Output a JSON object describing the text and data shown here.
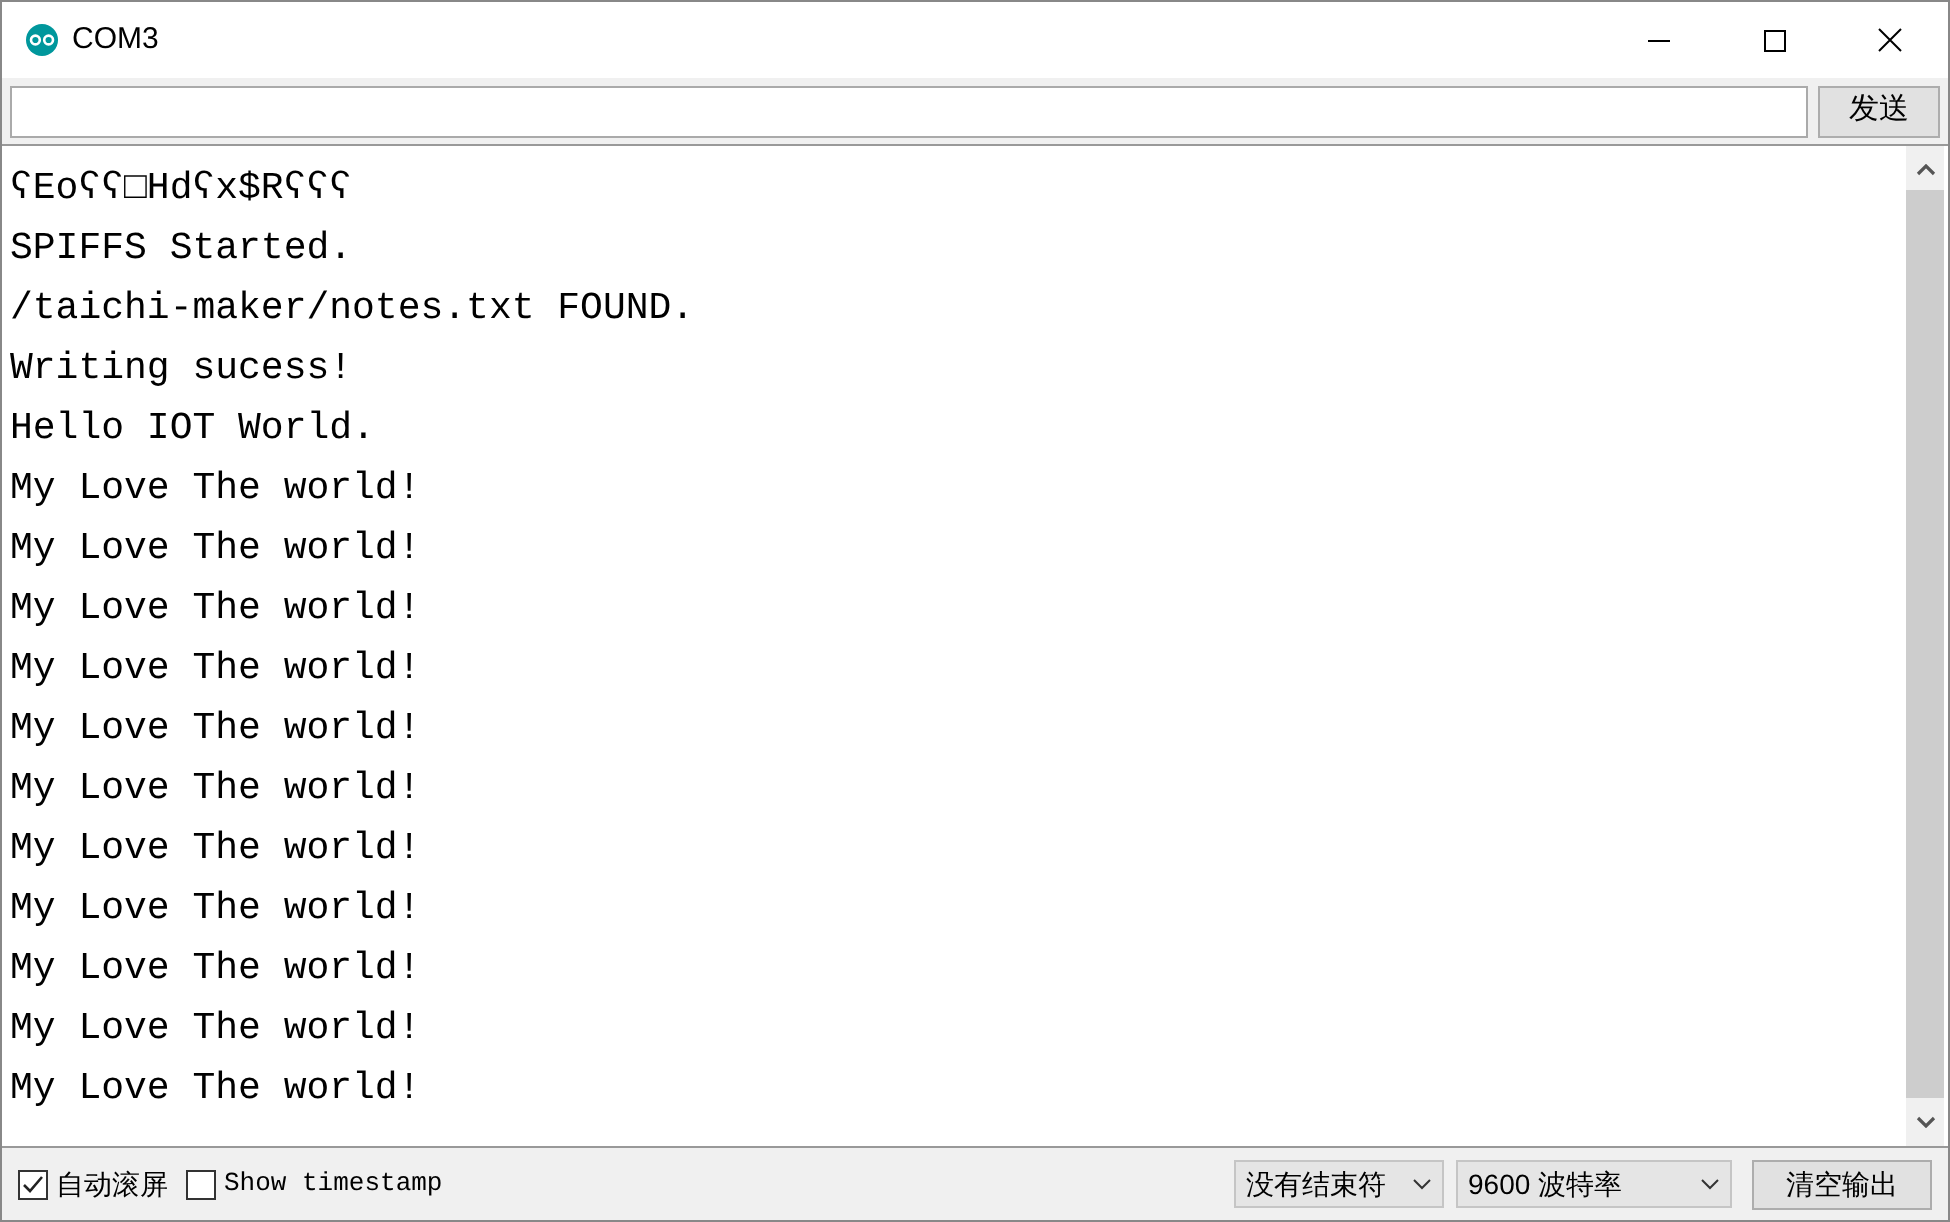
{
  "window": {
    "title": "COM3"
  },
  "send_button": "发送",
  "output_lines": [
    "ʕEoʕʕ□Hdʕx$Rʕʕʕ",
    "SPIFFS Started.",
    "/taichi-maker/notes.txt FOUND.",
    "Writing sucess!",
    "Hello IOT World.",
    "My Love The world!",
    "My Love The world!",
    "My Love The world!",
    "My Love The world!",
    "My Love The world!",
    "My Love The world!",
    "My Love The world!",
    "My Love The world!",
    "My Love The world!",
    "My Love The world!",
    "My Love The world!"
  ],
  "status_bar": {
    "autoscroll": {
      "label": "自动滚屏",
      "checked": true
    },
    "timestamp": {
      "label": "Show timestamp",
      "checked": false
    },
    "line_ending": "没有结束符",
    "baud_rate": "9600 波特率",
    "clear_button": "清空输出"
  }
}
